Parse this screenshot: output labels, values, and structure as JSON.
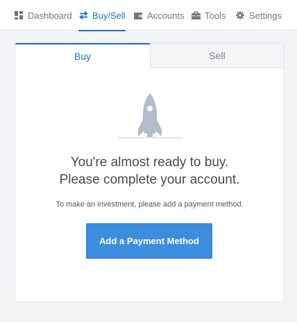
{
  "nav": {
    "items": [
      {
        "label": "Dashboard",
        "icon": "dashboard-grid-icon",
        "active": false
      },
      {
        "label": "Buy/Sell",
        "icon": "exchange-arrows-icon",
        "active": true
      },
      {
        "label": "Accounts",
        "icon": "wallet-icon",
        "active": false
      },
      {
        "label": "Tools",
        "icon": "toolbox-icon",
        "active": false
      },
      {
        "label": "Settings",
        "icon": "gear-icon",
        "active": false
      }
    ]
  },
  "tabs": {
    "buy": "Buy",
    "sell": "Sell",
    "active": "buy"
  },
  "main": {
    "illustration": "rocket-icon",
    "headline_line1": "You're almost ready to buy.",
    "headline_line2": "Please complete your account.",
    "subtext": "To make an investment, please add a payment method.",
    "cta_label": "Add a Payment Method"
  },
  "colors": {
    "accent": "#1f6fcf",
    "button": "#3c8ddd",
    "page_background": "#f3f4f6",
    "rocket": "#b3bcc8"
  }
}
